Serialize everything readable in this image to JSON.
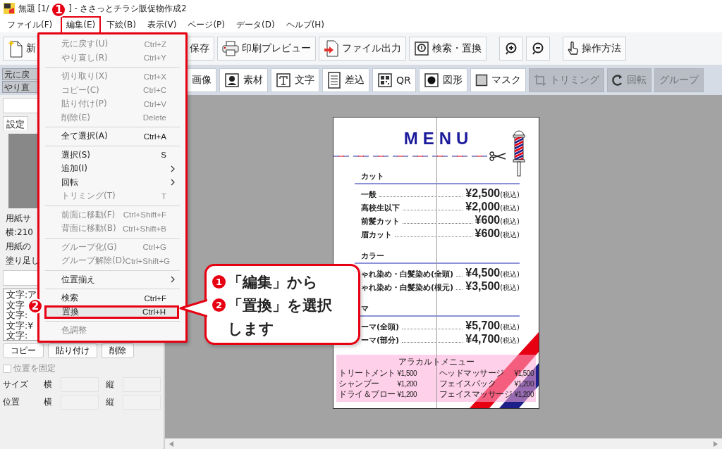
{
  "window": {
    "title_parts": [
      "無題 [1/",
      "] - ささっとチラシ販促物作成2"
    ]
  },
  "menubar": [
    {
      "label": "ファイル(F)",
      "selected": false
    },
    {
      "label": "編集(E)",
      "selected": true
    },
    {
      "label": "下絵(B)",
      "selected": false
    },
    {
      "label": "表示(V)",
      "selected": false
    },
    {
      "label": "ページ(P)",
      "selected": false
    },
    {
      "label": "データ(D)",
      "selected": false
    },
    {
      "label": "ヘルプ(H)",
      "selected": false
    }
  ],
  "toolbar": [
    [
      {
        "label": "新"
      }
    ],
    [
      {
        "label": "保存"
      },
      {
        "label": "印刷プレビュー"
      },
      {
        "label": "ファイル出力"
      },
      {
        "label": "検索・置換"
      }
    ],
    [
      {
        "kind": "zoom-in"
      },
      {
        "kind": "zoom-out"
      }
    ],
    [
      {
        "label": "操作方法"
      }
    ]
  ],
  "history_buttons": [
    "元に戻",
    "やり直"
  ],
  "object_toolbar": [
    {
      "label": "画像",
      "disabled": false
    },
    {
      "label": "素材",
      "disabled": false
    },
    {
      "label": "文字",
      "disabled": false
    },
    {
      "label": "差込",
      "disabled": false
    },
    {
      "label": "QR",
      "disabled": false
    },
    {
      "label": "図形",
      "disabled": false
    },
    {
      "label": "マスク",
      "disabled": false
    },
    {
      "label": "トリミング",
      "disabled": true
    },
    {
      "label": "回転",
      "disabled": true
    },
    {
      "label": "グループ",
      "disabled": true
    }
  ],
  "left_panel": {
    "tabs": [
      {
        "label": "設定",
        "selected": true
      }
    ],
    "info_lines": [
      "用紙サ",
      "横:210",
      "用紙の",
      "塗り足し"
    ],
    "list_lines": [
      "文字:ア",
      "文字",
      "文字:",
      "文字:¥",
      "文字:"
    ],
    "buttons": [
      "コピー",
      "貼り付け",
      "削除"
    ],
    "lock": {
      "label": "位置を固定",
      "checked": false,
      "disabled": true
    },
    "rows": [
      {
        "label": "サイズ",
        "x_label": "横",
        "y_label": "縦"
      },
      {
        "label": "位置",
        "x_label": "横",
        "y_label": "縦"
      }
    ]
  },
  "edit_menu": [
    {
      "kind": "item",
      "label": "元に戻す(U)",
      "shortcut": "Ctrl+Z",
      "disabled": true,
      "submenu": false,
      "selected": false
    },
    {
      "kind": "item",
      "label": "やり直し(R)",
      "shortcut": "Ctrl+Y",
      "disabled": true,
      "submenu": false,
      "selected": false
    },
    {
      "kind": "separator"
    },
    {
      "kind": "item",
      "label": "切り取り(X)",
      "shortcut": "Ctrl+X",
      "disabled": true,
      "submenu": false,
      "selected": false
    },
    {
      "kind": "item",
      "label": "コピー(C)",
      "shortcut": "Ctrl+C",
      "disabled": true,
      "submenu": false,
      "selected": false
    },
    {
      "kind": "item",
      "label": "貼り付け(P)",
      "shortcut": "Ctrl+V",
      "disabled": true,
      "submenu": false,
      "selected": false
    },
    {
      "kind": "item",
      "label": "削除(E)",
      "shortcut": "Delete",
      "disabled": true,
      "submenu": false,
      "selected": false
    },
    {
      "kind": "separator"
    },
    {
      "kind": "item",
      "label": "全て選択(A)",
      "shortcut": "Ctrl+A",
      "disabled": false,
      "submenu": false,
      "selected": false
    },
    {
      "kind": "separator"
    },
    {
      "kind": "item",
      "label": "選択(S)",
      "shortcut": "S",
      "disabled": false,
      "submenu": false,
      "selected": false
    },
    {
      "kind": "item",
      "label": "追加(I)",
      "disabled": false,
      "submenu": true,
      "selected": false
    },
    {
      "kind": "item",
      "label": "回転",
      "disabled": false,
      "submenu": true,
      "selected": false
    },
    {
      "kind": "item",
      "label": "トリミング(T)",
      "shortcut": "T",
      "disabled": true,
      "submenu": false,
      "selected": false
    },
    {
      "kind": "separator"
    },
    {
      "kind": "item",
      "label": "前面に移動(F)",
      "shortcut": "Ctrl+Shift+F",
      "disabled": true,
      "submenu": false,
      "selected": false
    },
    {
      "kind": "item",
      "label": "背面に移動(B)",
      "shortcut": "Ctrl+Shift+B",
      "disabled": true,
      "submenu": false,
      "selected": false
    },
    {
      "kind": "separator"
    },
    {
      "kind": "item",
      "label": "グループ化(G)",
      "shortcut": "Ctrl+G",
      "disabled": true,
      "submenu": false,
      "selected": false
    },
    {
      "kind": "item",
      "label": "グループ解除(D)",
      "shortcut": "Ctrl+Shift+G",
      "disabled": true,
      "submenu": false,
      "selected": false
    },
    {
      "kind": "separator"
    },
    {
      "kind": "item",
      "label": "位置揃え",
      "disabled": false,
      "submenu": true,
      "selected": false
    },
    {
      "kind": "separator"
    },
    {
      "kind": "item",
      "label": "検索",
      "shortcut": "Ctrl+F",
      "disabled": false,
      "submenu": false,
      "selected": false
    },
    {
      "kind": "item",
      "label": "置換",
      "shortcut": "Ctrl+H",
      "disabled": false,
      "submenu": false,
      "selected": true
    },
    {
      "kind": "separator"
    },
    {
      "kind": "item",
      "label": "色調整",
      "disabled": true,
      "submenu": false,
      "selected": false
    }
  ],
  "flyer": {
    "title": "MENU",
    "sections": [
      {
        "heading": "カット",
        "items": [
          {
            "name": "一般",
            "price": "¥2,500",
            "tax": "(税込)"
          },
          {
            "name": "高校生以下",
            "price": "¥2,000",
            "tax": "(税込)"
          },
          {
            "name": "前髪カット",
            "price": "¥600",
            "tax": "(税込)"
          },
          {
            "name": "眉カット",
            "price": "¥600",
            "tax": "(税込)"
          }
        ]
      },
      {
        "heading": "カラー",
        "items": [
          {
            "name": "ゃれ染め・白髪染め(全頭)",
            "price": "¥4,500",
            "tax": "(税込)"
          },
          {
            "name": "ゃれ染め・白髪染め(根元)",
            "price": "¥3,500",
            "tax": "(税込)"
          }
        ]
      },
      {
        "heading": "マ",
        "items": [
          {
            "name": "ーマ(全頭)",
            "price": "¥5,700",
            "tax": "(税込)"
          },
          {
            "name": "ーマ(部分)",
            "price": "¥4,700",
            "tax": "(税込)"
          }
        ]
      }
    ],
    "alacarte": {
      "title": "アラカルトメニュー",
      "columns": [
        [
          {
            "name": "トリートメント",
            "price": "¥1,500"
          },
          {
            "name": "シャンプー",
            "price": "¥1,200"
          },
          {
            "name": "ドライ＆ブロー",
            "price": "¥1,200"
          }
        ],
        [
          {
            "name": "ヘッドマッサージ",
            "price": "¥1,500"
          },
          {
            "name": "フェイスパック",
            "price": "¥1,200"
          },
          {
            "name": "フェイスマッサージ",
            "price": "¥1,200"
          }
        ]
      ]
    }
  },
  "step_badges": [
    "1",
    "2"
  ],
  "callout": {
    "lines": [
      {
        "badge": "1",
        "text": "「編集」から"
      },
      {
        "badge": "2",
        "text": "「置換」を選択"
      },
      {
        "text": "します"
      }
    ]
  }
}
